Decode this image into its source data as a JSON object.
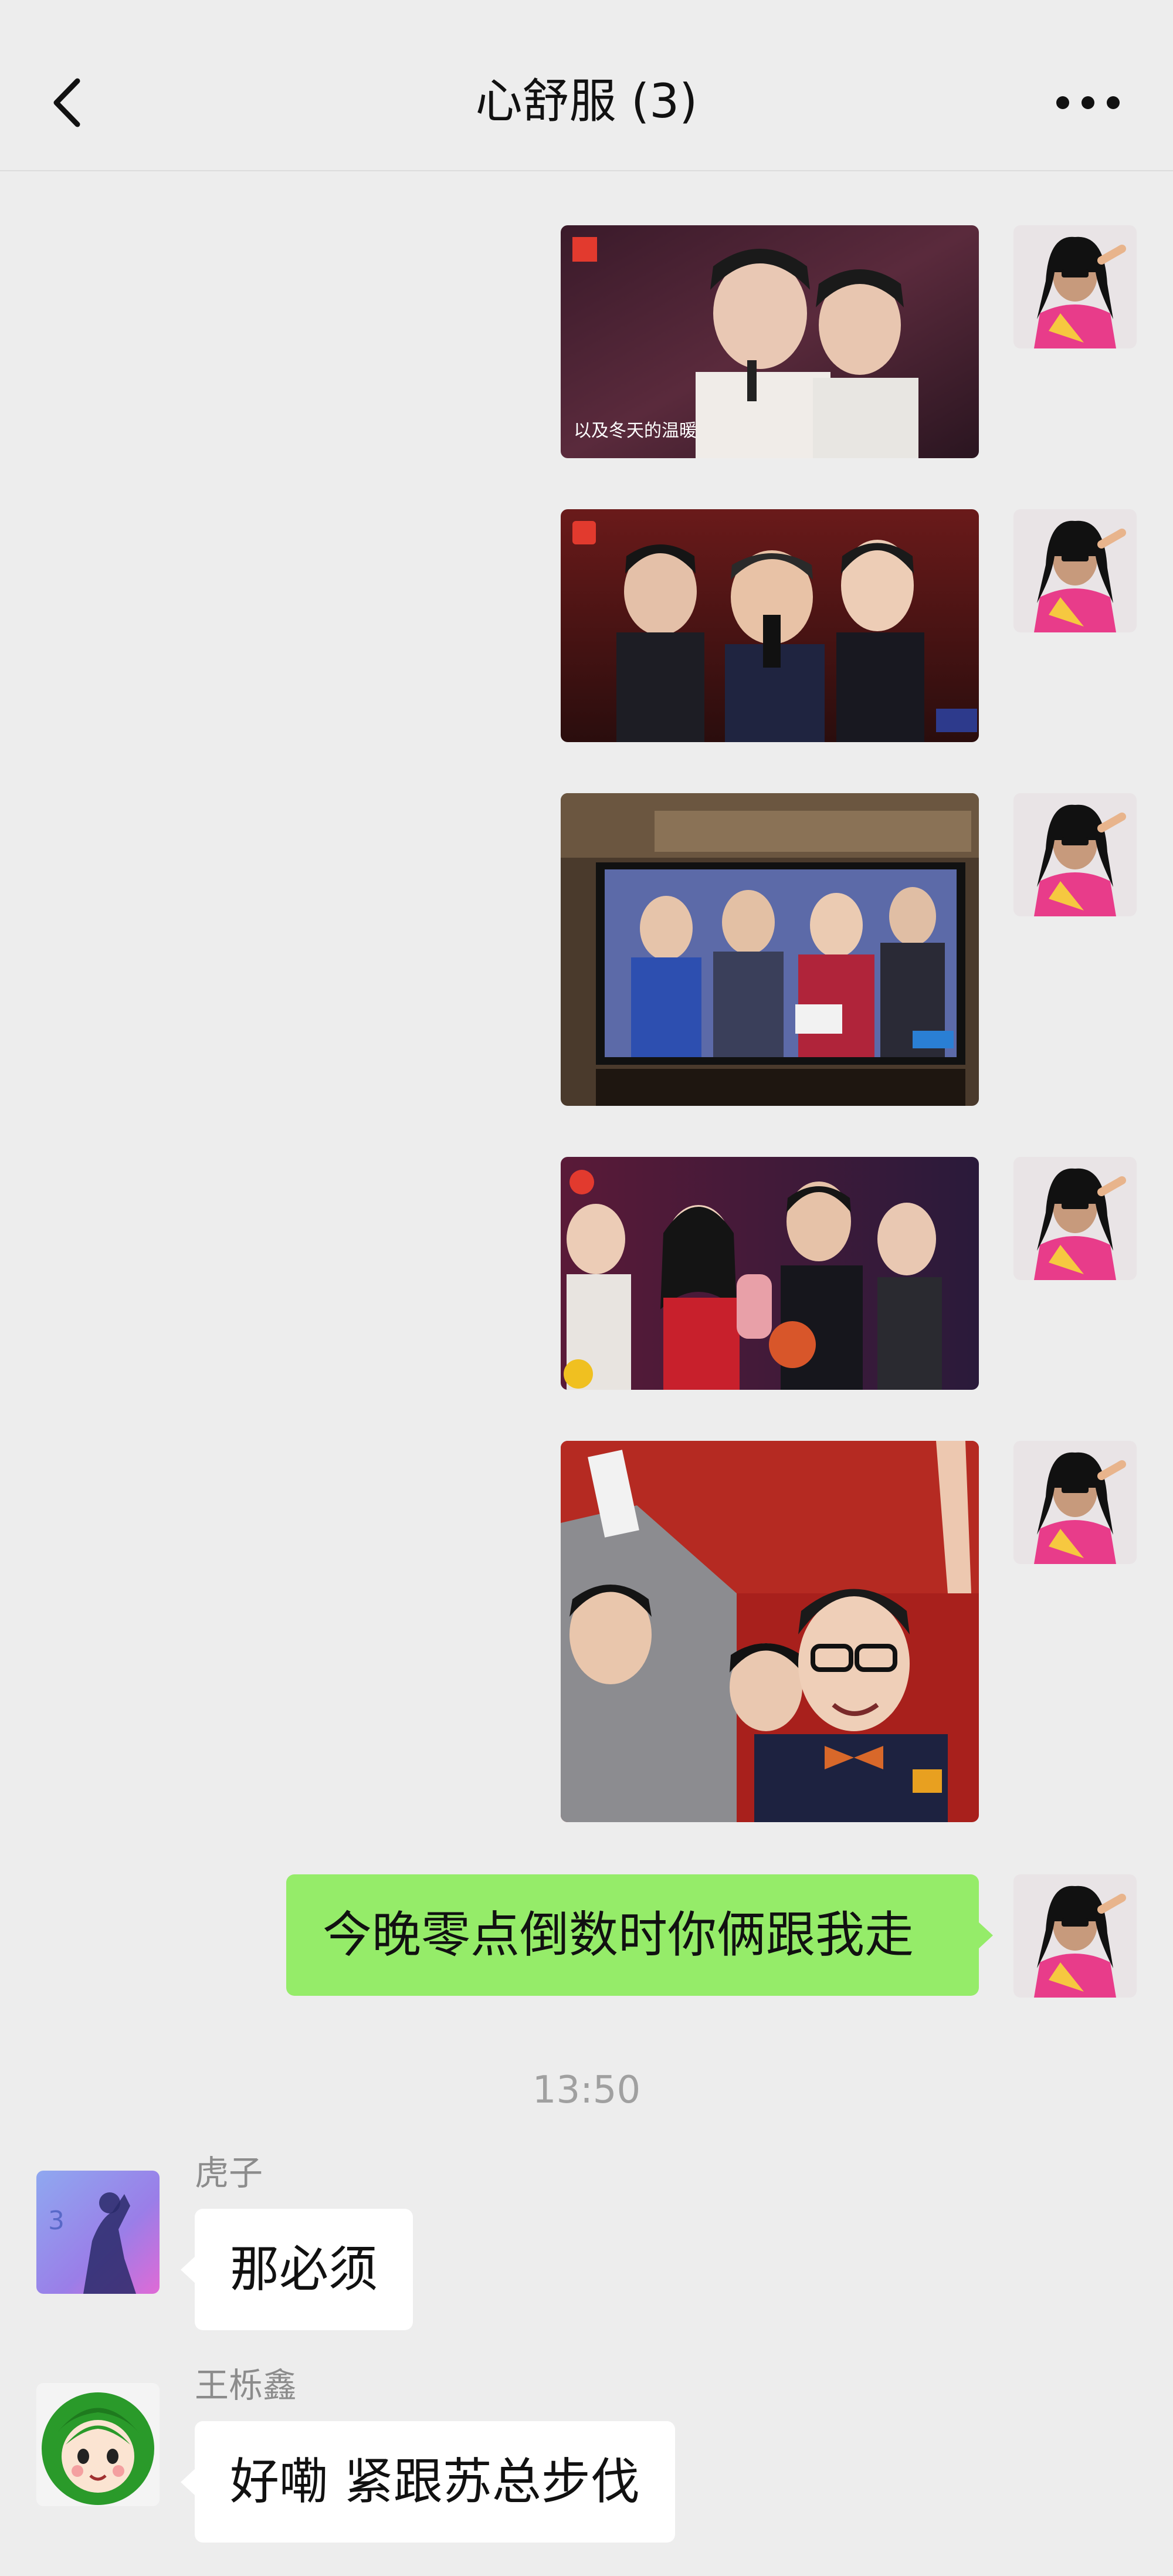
{
  "header": {
    "title": "心舒服 (3)"
  },
  "icons": {
    "back": "chevron-left-icon",
    "more": "more-horizontal-icon"
  },
  "colors": {
    "background": "#ededed",
    "my_bubble": "#95ec69",
    "other_bubble": "#ffffff"
  },
  "photos": [
    {
      "caption": "以及冬天的温暖"
    },
    {
      "caption": ""
    },
    {
      "caption": ""
    },
    {
      "caption": ""
    },
    {
      "caption": ""
    }
  ],
  "messages": {
    "me_text": "今晚零点倒数时你俩跟我走",
    "timestamp": "13:50",
    "hu_sender": "虎子",
    "hu_text": "那必须",
    "wang_sender": "王栎鑫",
    "wang_text": "好嘞 紧跟苏总步伐"
  },
  "avatars": {
    "wang_badge": "3"
  }
}
